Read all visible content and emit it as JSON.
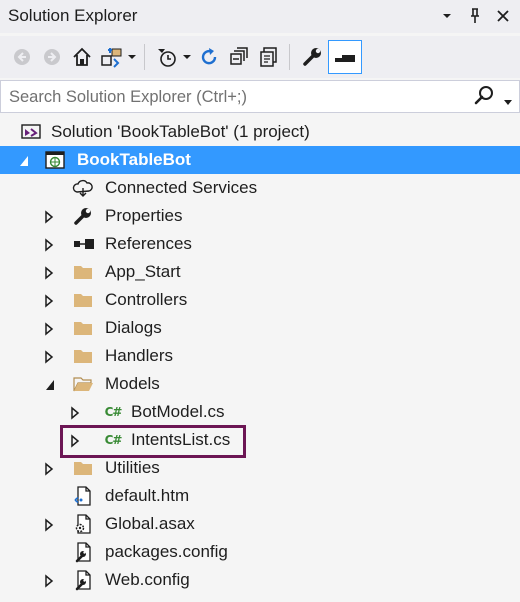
{
  "window": {
    "title": "Solution Explorer",
    "controls": [
      "dropdown-icon",
      "pin-icon",
      "close-icon"
    ]
  },
  "toolbar": {
    "buttons": [
      "back-icon",
      "forward-icon",
      "home-icon",
      "switch-views-icon",
      "pending-changes-filter-icon",
      "refresh-icon",
      "collapse-all-icon",
      "show-all-files-icon",
      "properties-icon",
      "preview-selected-icon"
    ]
  },
  "search": {
    "placeholder": "Search Solution Explorer (Ctrl+;)"
  },
  "tree": {
    "items": [
      {
        "label": "Solution 'BookTableBot' (1 project)",
        "icon": "solution-icon",
        "expander": "none"
      },
      {
        "label": "BookTableBot",
        "icon": "web-project-icon",
        "expander": "expanded",
        "selected": true
      },
      {
        "label": "Connected Services",
        "icon": "connected-services-icon",
        "expander": "none"
      },
      {
        "label": "Properties",
        "icon": "wrench-icon",
        "expander": "collapsed"
      },
      {
        "label": "References",
        "icon": "references-icon",
        "expander": "collapsed"
      },
      {
        "label": "App_Start",
        "icon": "folder-icon",
        "expander": "collapsed"
      },
      {
        "label": "Controllers",
        "icon": "folder-icon",
        "expander": "collapsed"
      },
      {
        "label": "Dialogs",
        "icon": "folder-icon",
        "expander": "collapsed"
      },
      {
        "label": "Handlers",
        "icon": "folder-icon",
        "expander": "collapsed"
      },
      {
        "label": "Models",
        "icon": "open-folder-icon",
        "expander": "expanded"
      },
      {
        "label": "BotModel.cs",
        "icon": "csharp-file-icon",
        "expander": "collapsed"
      },
      {
        "label": "IntentsList.cs",
        "icon": "csharp-file-icon",
        "expander": "collapsed",
        "highlighted": true
      },
      {
        "label": "Utilities",
        "icon": "folder-icon",
        "expander": "collapsed"
      },
      {
        "label": "default.htm",
        "icon": "html-file-icon",
        "expander": "none"
      },
      {
        "label": "Global.asax",
        "icon": "asax-file-icon",
        "expander": "collapsed"
      },
      {
        "label": "packages.config",
        "icon": "config-file-icon",
        "expander": "none"
      },
      {
        "label": "Web.config",
        "icon": "config-file-icon",
        "expander": "collapsed"
      }
    ],
    "csharp_glyph": "C#"
  },
  "colors": {
    "selection": "#3399ff",
    "highlight_border": "#6c1654",
    "folder": "#dcb67a",
    "csharp": "#388a34"
  }
}
